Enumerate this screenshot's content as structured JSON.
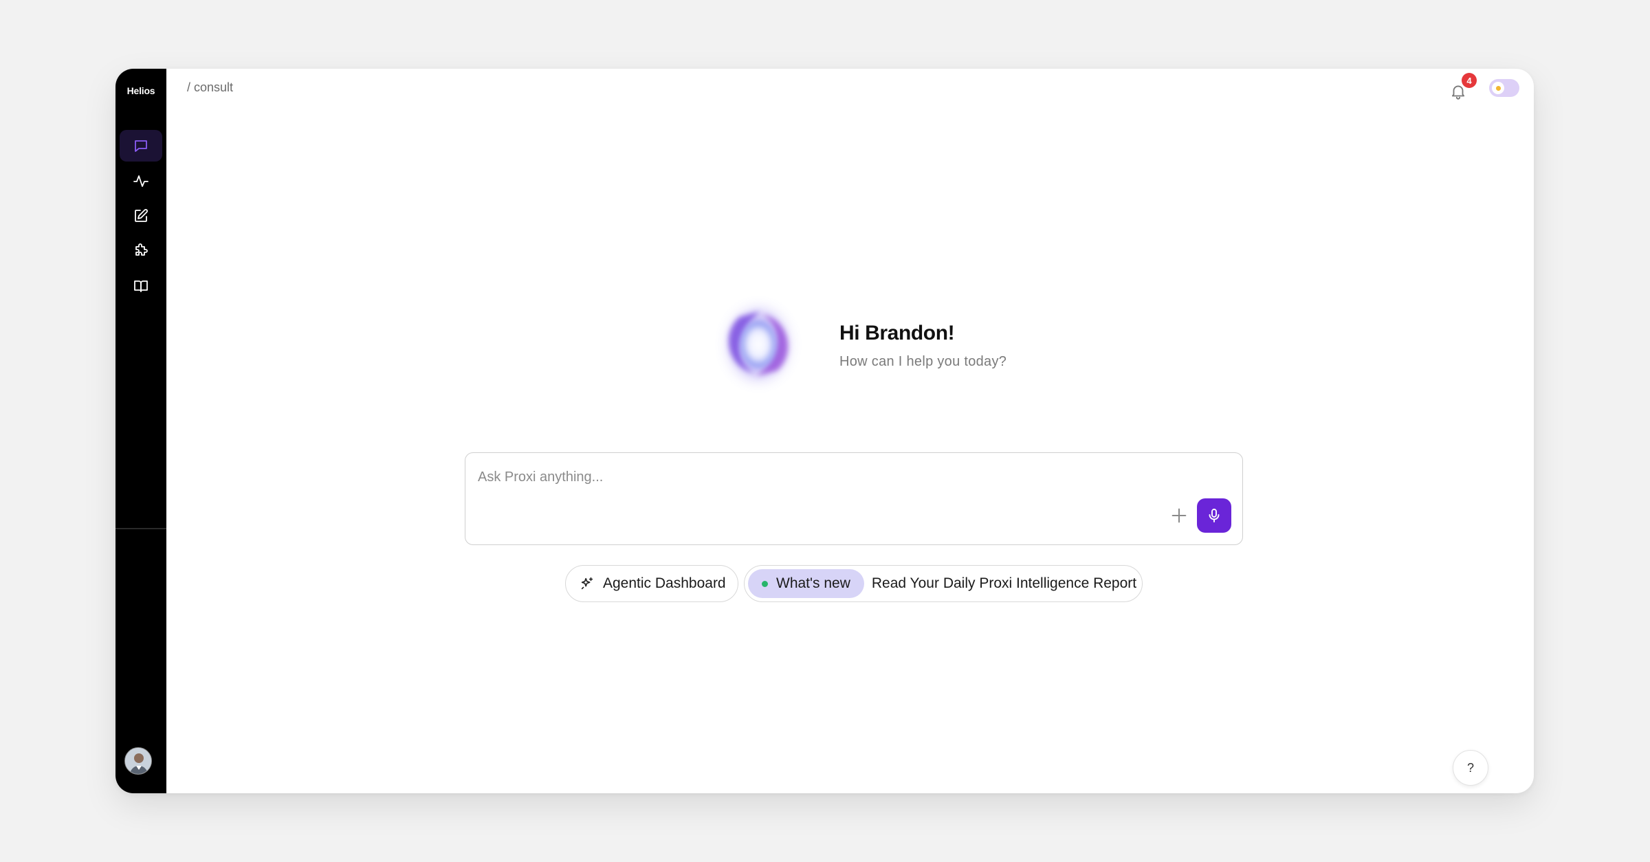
{
  "app": {
    "brand": "Helios"
  },
  "header": {
    "breadcrumb": "/ consult",
    "notifications_count": "4"
  },
  "sidebar": {
    "items": [
      {
        "icon": "chat-icon",
        "active": true
      },
      {
        "icon": "activity-icon",
        "active": false
      },
      {
        "icon": "edit-icon",
        "active": false
      },
      {
        "icon": "puzzle-icon",
        "active": false
      },
      {
        "icon": "book-icon",
        "active": false
      }
    ],
    "user_avatar": "user-avatar"
  },
  "greeting": {
    "title": "Hi Brandon!",
    "subtitle": "How can I help you today?"
  },
  "composer": {
    "placeholder": "Ask Proxi anything...",
    "value": ""
  },
  "chips": {
    "agentic_label": "Agentic Dashboard",
    "whats_new_label": "What's new",
    "report_label": "Read Your Daily Proxi Intelligence Report"
  },
  "help": {
    "label": "?"
  },
  "colors": {
    "accent": "#6a25d8",
    "sidebar_bg": "#000000",
    "badge": "#e5383b",
    "whats_new_pill": "#d7d4f7",
    "status_dot": "#27b56b"
  }
}
